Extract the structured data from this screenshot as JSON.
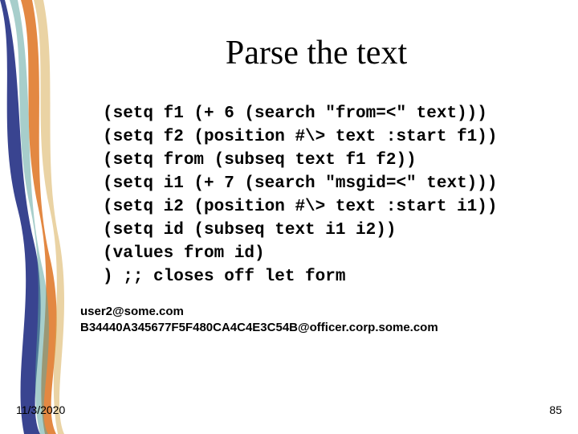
{
  "title": "Parse the text",
  "code_lines": [
    "(setq f1 (+ 6 (search \"from=<\" text)))",
    "(setq f2 (position #\\> text :start f1))",
    "(setq from (subseq text f1 f2))",
    "(setq i1 (+ 7 (search \"msgid=<\" text)))",
    "(setq i2 (position #\\> text :start i1))",
    "(setq id (subseq text i1 i2))",
    "(values from id)",
    ") ;; closes off let form"
  ],
  "output_lines": [
    "user2@some.com",
    "B34440A345677F5F480CA4C4E3C54B@officer.corp.some.com"
  ],
  "footer": {
    "date": "11/3/2020",
    "page": "85"
  },
  "colors": {
    "band_blue": "#2e3a8a",
    "band_orange": "#e07b2e",
    "band_teal": "#5fa6a0",
    "band_gold": "#d6a84a"
  }
}
